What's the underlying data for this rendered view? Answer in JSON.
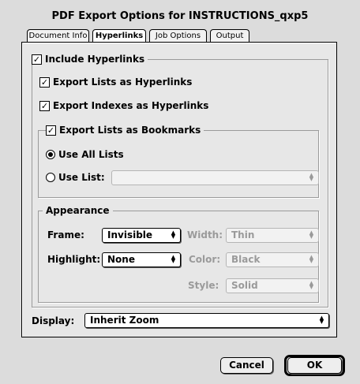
{
  "window": {
    "title": "PDF Export Options for INSTRUCTIONS_qxp5"
  },
  "tabs": [
    {
      "label": "Document Info",
      "active": false
    },
    {
      "label": "Hyperlinks",
      "active": true
    },
    {
      "label": "Job Options",
      "active": false
    },
    {
      "label": "Output",
      "active": false
    }
  ],
  "hyperlinks": {
    "include_hyperlinks": {
      "label": "Include Hyperlinks",
      "checked": true
    },
    "export_lists": {
      "label": "Export Lists as Hyperlinks",
      "checked": true
    },
    "export_indexes": {
      "label": "Export Indexes as Hyperlinks",
      "checked": true
    },
    "export_bookmarks": {
      "label": "Export Lists as Bookmarks",
      "checked": true
    },
    "use_all_lists": {
      "label": "Use All Lists",
      "selected": true
    },
    "use_list": {
      "label": "Use List:",
      "selected": false,
      "value": ""
    },
    "appearance": {
      "title": "Appearance",
      "frame_label": "Frame:",
      "frame_value": "Invisible",
      "width_label": "Width:",
      "width_value": "Thin",
      "highlight_label": "Highlight:",
      "highlight_value": "None",
      "color_label": "Color:",
      "color_value": "Black",
      "style_label": "Style:",
      "style_value": "Solid"
    },
    "display_label": "Display:",
    "display_value": "Inherit Zoom"
  },
  "buttons": {
    "cancel": "Cancel",
    "ok": "OK"
  },
  "icons": {
    "checkmark": "✓",
    "popup_arrows": "▲▼"
  }
}
